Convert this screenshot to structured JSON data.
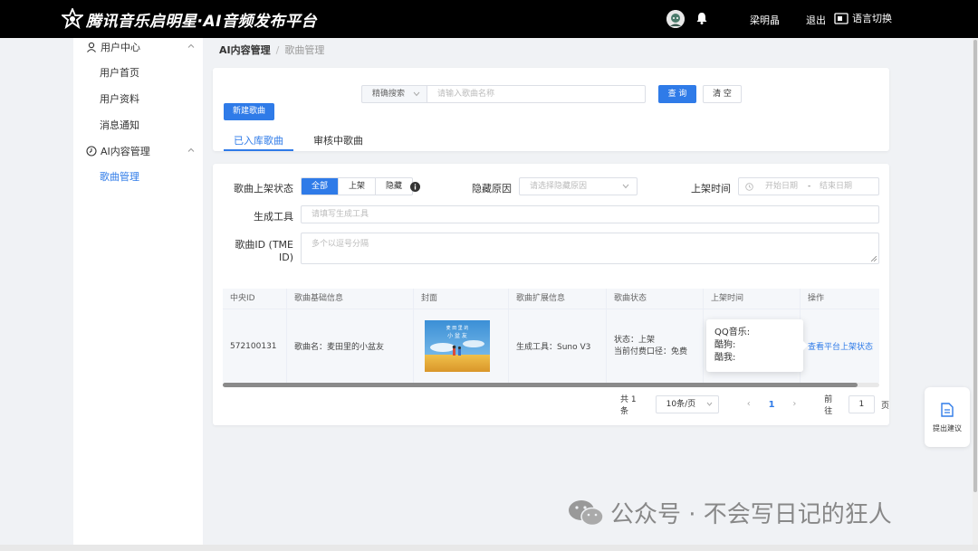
{
  "app": {
    "title": "腾讯音乐启明星·AI音频发布平台",
    "user_name": "梁明晶",
    "logout": "退出",
    "language": "语言切换"
  },
  "sidebar": {
    "groups": [
      {
        "label": "用户中心",
        "items": [
          "用户首页",
          "用户资料",
          "消息通知"
        ]
      },
      {
        "label": "AI内容管理",
        "items": [
          "歌曲管理"
        ]
      }
    ]
  },
  "breadcrumb": {
    "parent": "AI内容管理",
    "current": "歌曲管理",
    "separator": "/"
  },
  "search": {
    "mode": "精确搜索",
    "placeholder": "请输入歌曲名称",
    "query_button": "查 询",
    "clear_button": "清 空",
    "new_button": "新建歌曲"
  },
  "tabs": [
    {
      "label": "已入库歌曲",
      "active": true
    },
    {
      "label": "审核中歌曲",
      "active": false
    }
  ],
  "filters": {
    "status_label": "歌曲上架状态",
    "status_options": [
      "全部",
      "上架",
      "隐藏"
    ],
    "status_selected": "全部",
    "hide_reason_label": "隐藏原因",
    "hide_reason_placeholder": "请选择隐藏原因",
    "publish_time_label": "上架时间",
    "start_date_placeholder": "开始日期",
    "date_separator": "-",
    "end_date_placeholder": "结束日期",
    "tool_label": "生成工具",
    "tool_placeholder": "请填写生成工具",
    "songid_label": "歌曲ID (TME ID)",
    "songid_placeholder": "多个以逗号分隔"
  },
  "table": {
    "headers": [
      "中央ID",
      "歌曲基础信息",
      "封面",
      "歌曲扩展信息",
      "歌曲状态",
      "上架时间",
      "操作"
    ],
    "rows": [
      {
        "central_id": "572100131",
        "basic_info": "歌曲名：麦田里的小盆友",
        "extended_info": "生成工具：Suno V3",
        "status_line1": "状态：上架",
        "status_line2": "当前付费口径：免费",
        "publish_platforms": [
          "QQ音乐:",
          "酷狗:",
          "酷我:"
        ],
        "action": "查看平台上架状态"
      }
    ]
  },
  "pagination": {
    "total": "共 1 条",
    "page_size": "10条/页",
    "current_page": "1",
    "goto_label": "前往",
    "goto_value": "1",
    "page_unit": "页"
  },
  "suggest": {
    "label": "提出建议"
  },
  "watermark": {
    "text": "公众号 · 不会写日记的狂人"
  },
  "colors": {
    "primary": "#2f7be8",
    "topbar": "#000000",
    "background": "#f0f2f5"
  }
}
